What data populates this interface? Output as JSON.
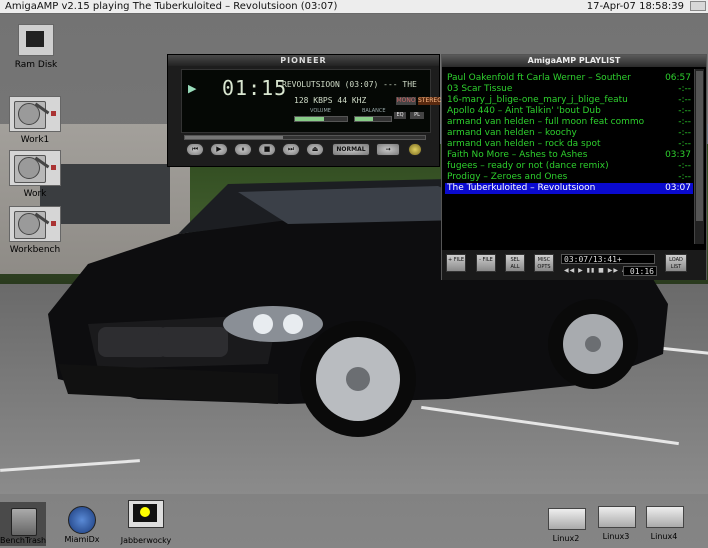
{
  "screen_title": "AmigaAMP v2.15 playing The Tuberkuloited – Revolutsioon (03:07)",
  "clock": "17-Apr-07 18:58:39",
  "desktop_icons": {
    "ram_disk": "Ram Disk",
    "work1": "Work1",
    "work": "Work",
    "workbench": "Workbench",
    "bench_trash": "BenchTrash",
    "miami_dx": "MiamiDx",
    "jabberwocky": "Jabberwocky",
    "linux2": "Linux2",
    "linux3": "Linux3",
    "linux4": "Linux4"
  },
  "player": {
    "brand": "PIONEER",
    "time": "01:15",
    "song": "REVOLUTSIOON (03:07) --- THE",
    "kbps": "128",
    "kbps_unit": "KBPS",
    "khz": "44",
    "khz_unit": "KHZ",
    "volume_label": "VOLUME",
    "balance_label": "BALANCE",
    "mono_label": "MONO",
    "stereo_label": "STEREO",
    "mode_label": "NORMAL",
    "eq_label": "EQ",
    "pl_label": "PL",
    "volume_level": 0.55,
    "balance_level": 0.5,
    "seek_position": 0.41
  },
  "playlist": {
    "title": "AmigaAMP PLAYLIST",
    "items": [
      {
        "name": "Paul Oakenfold ft Carla Werner – Souther",
        "duration": "06:57"
      },
      {
        "name": "03 Scar Tissue",
        "duration": "-:--"
      },
      {
        "name": "16-mary_j_blige-one_mary_j_blige_featu",
        "duration": "-:--"
      },
      {
        "name": "Apollo 440 – Aint Talkin' 'bout Dub",
        "duration": "-:--"
      },
      {
        "name": "armand van helden – full moon feat commo",
        "duration": "-:--"
      },
      {
        "name": "armand van helden – koochy",
        "duration": "-:--"
      },
      {
        "name": "armand van helden – rock da spot",
        "duration": "-:--"
      },
      {
        "name": "Faith No More – Ashes to Ashes",
        "duration": "03:37"
      },
      {
        "name": "fugees – ready or not (dance remix)",
        "duration": "-:--"
      },
      {
        "name": "Prodigy – Zeroes and Ones",
        "duration": "-:--"
      },
      {
        "name": "The Tuberkuloited – Revolutsioon",
        "duration": "03:07"
      }
    ],
    "selected_index": 10,
    "buttons": {
      "add": "+ FILE",
      "rem": "- FILE",
      "sel": "SEL ALL",
      "misc": "MISC OPTS",
      "load": "LOAD LIST"
    },
    "info": "03:07/13:41+",
    "time": "01:16"
  },
  "colors": {
    "playlist_text": "#2ed02e",
    "playlist_selected_bg": "#0a0acf",
    "desktop": "#7a7a7a"
  }
}
